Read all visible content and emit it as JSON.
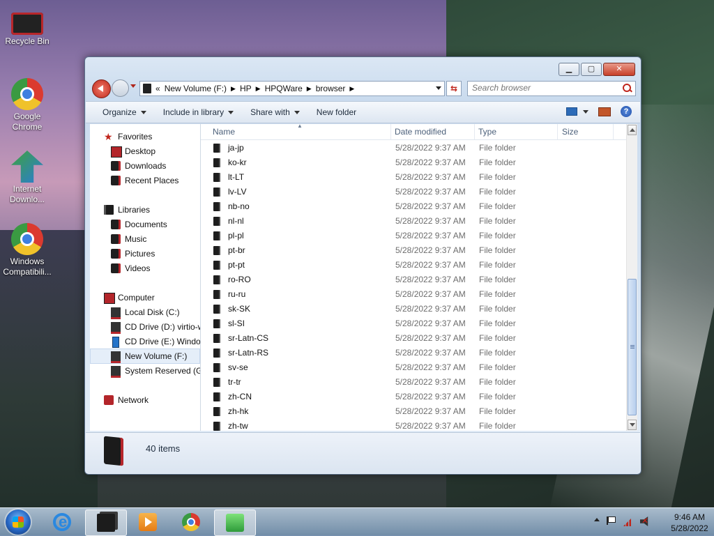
{
  "desktop": {
    "icons": [
      {
        "label": "Recycle Bin"
      },
      {
        "label": "Google Chrome"
      },
      {
        "label": "Internet Downlo..."
      },
      {
        "label": "Windows Compatibili..."
      }
    ]
  },
  "window": {
    "address": {
      "overflow": "«",
      "crumbs": [
        "New Volume (F:)",
        "HP",
        "HPQWare",
        "browser"
      ]
    },
    "search": {
      "placeholder": "Search browser"
    },
    "toolbar": {
      "organize": "Organize",
      "include_in_library": "Include in library",
      "share_with": "Share with",
      "new_folder": "New folder"
    },
    "nav": {
      "favorites": "Favorites",
      "desktop": "Desktop",
      "downloads": "Downloads",
      "recent_places": "Recent Places",
      "libraries": "Libraries",
      "documents": "Documents",
      "music": "Music",
      "pictures": "Pictures",
      "videos": "Videos",
      "computer": "Computer",
      "local_disk": "Local Disk (C:)",
      "cd_d": "CD Drive (D:) virtio-w",
      "cd_e": "CD Drive (E:) Window",
      "new_volume": "New Volume (F:)",
      "system_reserved": "System Reserved (G:",
      "network": "Network"
    },
    "columns": {
      "name": "Name",
      "date": "Date modified",
      "type": "Type",
      "size": "Size"
    },
    "files": [
      {
        "name": "ja-jp",
        "date": "5/28/2022 9:37 AM",
        "type": "File folder"
      },
      {
        "name": "ko-kr",
        "date": "5/28/2022 9:37 AM",
        "type": "File folder"
      },
      {
        "name": "lt-LT",
        "date": "5/28/2022 9:37 AM",
        "type": "File folder"
      },
      {
        "name": "lv-LV",
        "date": "5/28/2022 9:37 AM",
        "type": "File folder"
      },
      {
        "name": "nb-no",
        "date": "5/28/2022 9:37 AM",
        "type": "File folder"
      },
      {
        "name": "nl-nl",
        "date": "5/28/2022 9:37 AM",
        "type": "File folder"
      },
      {
        "name": "pl-pl",
        "date": "5/28/2022 9:37 AM",
        "type": "File folder"
      },
      {
        "name": "pt-br",
        "date": "5/28/2022 9:37 AM",
        "type": "File folder"
      },
      {
        "name": "pt-pt",
        "date": "5/28/2022 9:37 AM",
        "type": "File folder"
      },
      {
        "name": "ro-RO",
        "date": "5/28/2022 9:37 AM",
        "type": "File folder"
      },
      {
        "name": "ru-ru",
        "date": "5/28/2022 9:37 AM",
        "type": "File folder"
      },
      {
        "name": "sk-SK",
        "date": "5/28/2022 9:37 AM",
        "type": "File folder"
      },
      {
        "name": "sl-SI",
        "date": "5/28/2022 9:37 AM",
        "type": "File folder"
      },
      {
        "name": "sr-Latn-CS",
        "date": "5/28/2022 9:37 AM",
        "type": "File folder"
      },
      {
        "name": "sr-Latn-RS",
        "date": "5/28/2022 9:37 AM",
        "type": "File folder"
      },
      {
        "name": "sv-se",
        "date": "5/28/2022 9:37 AM",
        "type": "File folder"
      },
      {
        "name": "tr-tr",
        "date": "5/28/2022 9:37 AM",
        "type": "File folder"
      },
      {
        "name": "zh-CN",
        "date": "5/28/2022 9:37 AM",
        "type": "File folder"
      },
      {
        "name": "zh-hk",
        "date": "5/28/2022 9:37 AM",
        "type": "File folder"
      },
      {
        "name": "zh-tw",
        "date": "5/28/2022 9:37 AM",
        "type": "File folder"
      }
    ],
    "status": {
      "items": "40 items"
    }
  },
  "taskbar": {
    "clock": {
      "time": "9:46 AM",
      "date": "5/28/2022"
    }
  },
  "colors": {
    "accent_red": "#c0261c",
    "window_frame": "#cadbee",
    "selection": "#e5eef9"
  }
}
